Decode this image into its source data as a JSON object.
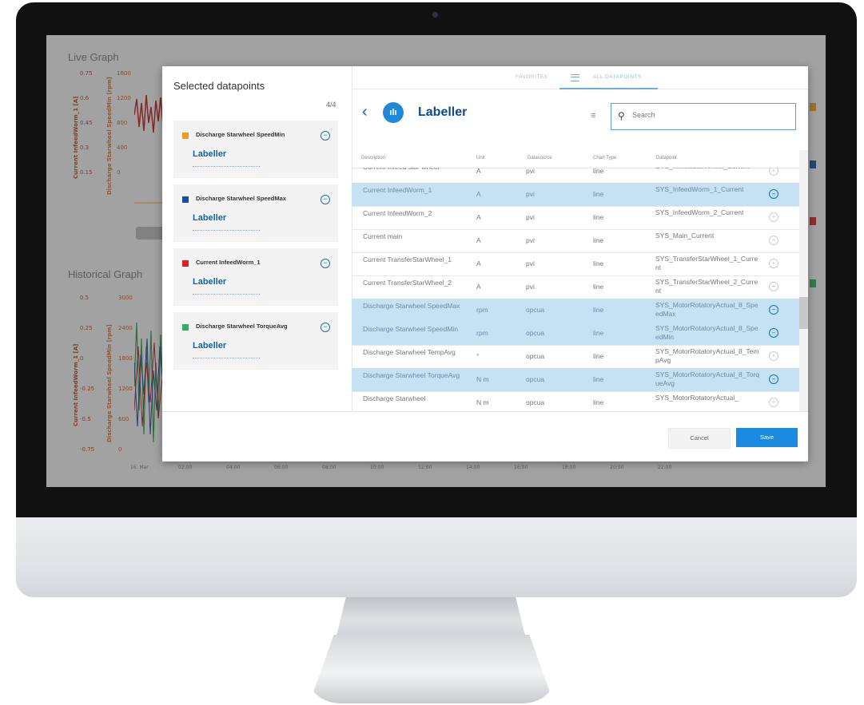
{
  "background": {
    "live_title": "Live Graph",
    "historical_title": "Historical Graph",
    "live_ticks_left": [
      "0.75",
      "0.6",
      "0.45",
      "0.3",
      "0.15"
    ],
    "live_ticks_right": [
      "1600",
      "1200",
      "800",
      "400",
      "0"
    ],
    "live_axis_left": "Current InfeedWorm_1 [A]",
    "live_axis_right": "Discharge Starwheel SpeedMin [rpm]",
    "hist_ticks_left": [
      "0.5",
      "0.25",
      "0",
      "-0.25",
      "-0.5",
      "-0.75"
    ],
    "hist_ticks_right": [
      "3000",
      "2400",
      "1800",
      "1200",
      "600",
      "0"
    ],
    "hist_axis_left": "Current InfeedWorm_1 [A]",
    "hist_axis_right": "Discharge Starwheel SpeedMin [rpm]",
    "x_ticks": [
      "16. Mar",
      "02:00",
      "04:00",
      "06:00",
      "08:00",
      "10:00",
      "12:00",
      "14:00",
      "16:00",
      "18:00",
      "20:00",
      "22:00"
    ]
  },
  "modal": {
    "left": {
      "heading": "Selected datapoints",
      "count": "4/4",
      "cards": [
        {
          "name": "Discharge Starwheel SpeedMin",
          "source": "Labeller",
          "color": "#f0a020"
        },
        {
          "name": "Discharge Starwheel SpeedMax",
          "source": "Labeller",
          "color": "#1a4e9c"
        },
        {
          "name": "Current InfeedWorm_1",
          "source": "Labeller",
          "color": "#e02020"
        },
        {
          "name": "Discharge Starwheel TorqueAvg",
          "source": "Labeller",
          "color": "#30b060"
        }
      ]
    },
    "tabs": {
      "favorites": "FAVORITES",
      "all": "ALL DATAPOINTS"
    },
    "title": "Labeller",
    "logo_glyph": "ılı",
    "search": {
      "placeholder": "Search"
    },
    "columns": [
      "Description",
      "Unit",
      "Datasource",
      "Chart Type",
      "Datapoint"
    ],
    "rows": [
      {
        "desc": "Current Infeed star wheel",
        "unit": "A",
        "source": "pvi",
        "chart": "line",
        "datapoint": "SYS_InfeedStarWheel_Current",
        "selected": false
      },
      {
        "desc": "Current InfeedWorm_1",
        "unit": "A",
        "source": "pvi",
        "chart": "line",
        "datapoint": "SYS_InfeedWorm_1_Current",
        "selected": true
      },
      {
        "desc": "Current InfeedWorm_2",
        "unit": "A",
        "source": "pvi",
        "chart": "line",
        "datapoint": "SYS_InfeedWorm_2_Current",
        "selected": false
      },
      {
        "desc": "Current main",
        "unit": "A",
        "source": "pvi",
        "chart": "line",
        "datapoint": "SYS_Main_Current",
        "selected": false
      },
      {
        "desc": "Current TransferStarWheel_1",
        "unit": "A",
        "source": "pvi",
        "chart": "line",
        "datapoint": "SYS_TransferStarWheel_1_Current",
        "selected": false
      },
      {
        "desc": "Current TransferStarWheel_2",
        "unit": "A",
        "source": "pvi",
        "chart": "line",
        "datapoint": "SYS_TransferStarWheel_2_Current",
        "selected": false
      },
      {
        "desc": "Discharge Starwheel SpeedMax",
        "unit": "rpm",
        "source": "opcua",
        "chart": "line",
        "datapoint": "SYS_MotorRotatoryActual_8_SpeedMax",
        "selected": true
      },
      {
        "desc": "Discharge Starwheel SpeedMin",
        "unit": "rpm",
        "source": "opcua",
        "chart": "line",
        "datapoint": "SYS_MotorRotatoryActual_8_SpeedMin",
        "selected": true
      },
      {
        "desc": "Discharge Starwheel TempAvg",
        "unit": "°",
        "source": "opcua",
        "chart": "line",
        "datapoint": "SYS_MotorRotatoryActual_8_TempAvg",
        "selected": false
      },
      {
        "desc": "Discharge Starwheel TorqueAvg",
        "unit": "N m",
        "source": "opcua",
        "chart": "line",
        "datapoint": "SYS_MotorRotatoryActual_8_TorqueAvg",
        "selected": true
      },
      {
        "desc": "Discharge Starwheel",
        "unit": "N m",
        "source": "opcua",
        "chart": "line",
        "datapoint": "SYS_MotorRotatoryActual_",
        "selected": false
      }
    ],
    "buttons": {
      "cancel": "Cancel",
      "save": "Save"
    }
  }
}
